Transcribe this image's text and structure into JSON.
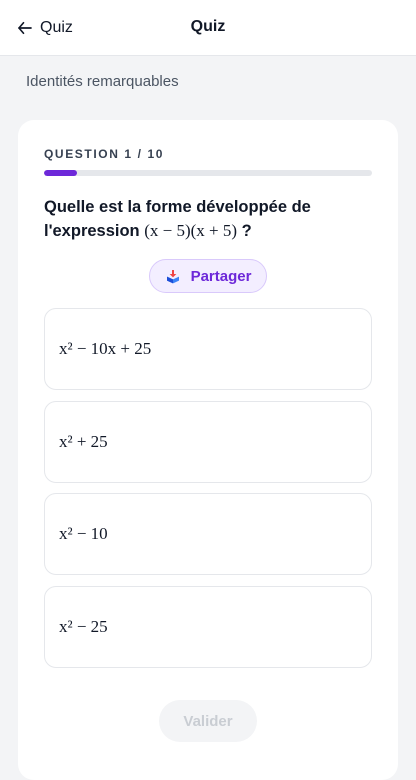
{
  "topbar": {
    "back_label": "Quiz",
    "title": "Quiz"
  },
  "subtitle": "Identités remarquables",
  "question": {
    "counter": "QUESTION 1 / 10",
    "progress_fraction": 0.1,
    "text": "Quelle est la forme développée de l'expression",
    "expression": "(x − 5)(x + 5)",
    "suffix": " ?"
  },
  "share": {
    "label": "Partager",
    "icon": "share-icon"
  },
  "options": [
    {
      "text": "x² − 10x + 25"
    },
    {
      "text": "x² + 25"
    },
    {
      "text": "x² − 10"
    },
    {
      "text": "x² − 25"
    }
  ],
  "validate_label": "Valider",
  "colors": {
    "accent": "#6D28D9",
    "accent_light": "#F3EEFF",
    "border": "#E5E7EB",
    "disabled_text": "#C9CDD3"
  }
}
